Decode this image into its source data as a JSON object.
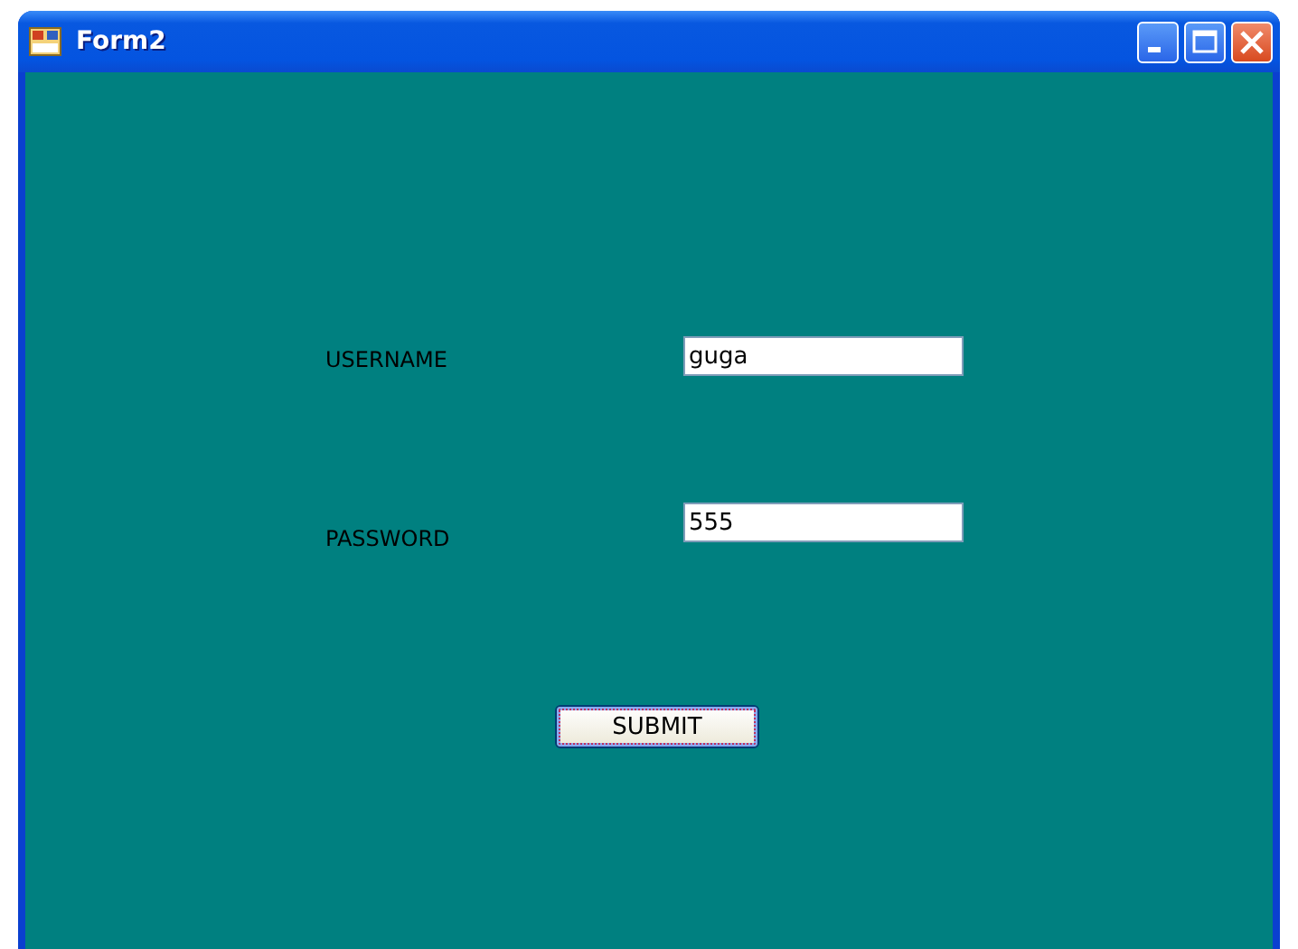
{
  "window": {
    "title": "Form2"
  },
  "fields": [
    {
      "label": "USERNAME",
      "value": "guga"
    },
    {
      "label": "PASSWORD",
      "value": "555"
    }
  ],
  "buttons": [
    {
      "label": "SUBMIT",
      "focused": true
    }
  ]
}
